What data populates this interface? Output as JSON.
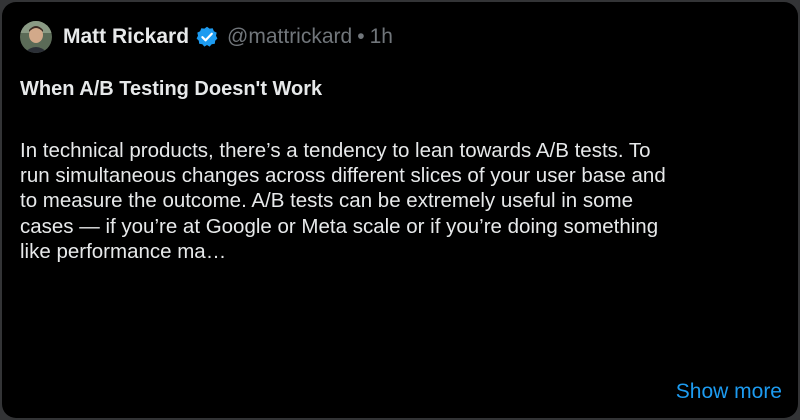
{
  "post": {
    "author": {
      "name": "Matt Rickard",
      "handle": "@mattrickard",
      "verified_icon": "verified-badge-icon",
      "avatar_icon": "avatar-photo"
    },
    "separator": "•",
    "time": "1h",
    "title": "When A/B Testing Doesn't Work",
    "body_lines": [
      "In technical products, there’s a tendency to lean towards A/B tests. To",
      "run simultaneous changes across different slices of your user base and",
      "to measure the outcome. A/B tests can be extremely useful in some",
      "cases — if you’re at Google or Meta scale or if you’re doing something",
      "like performance ma…"
    ],
    "show_more": "Show more"
  },
  "colors": {
    "background": "#000000",
    "outer": "#333436",
    "text": "#e7e9ea",
    "muted": "#71767b",
    "accent": "#1d9bf0"
  }
}
